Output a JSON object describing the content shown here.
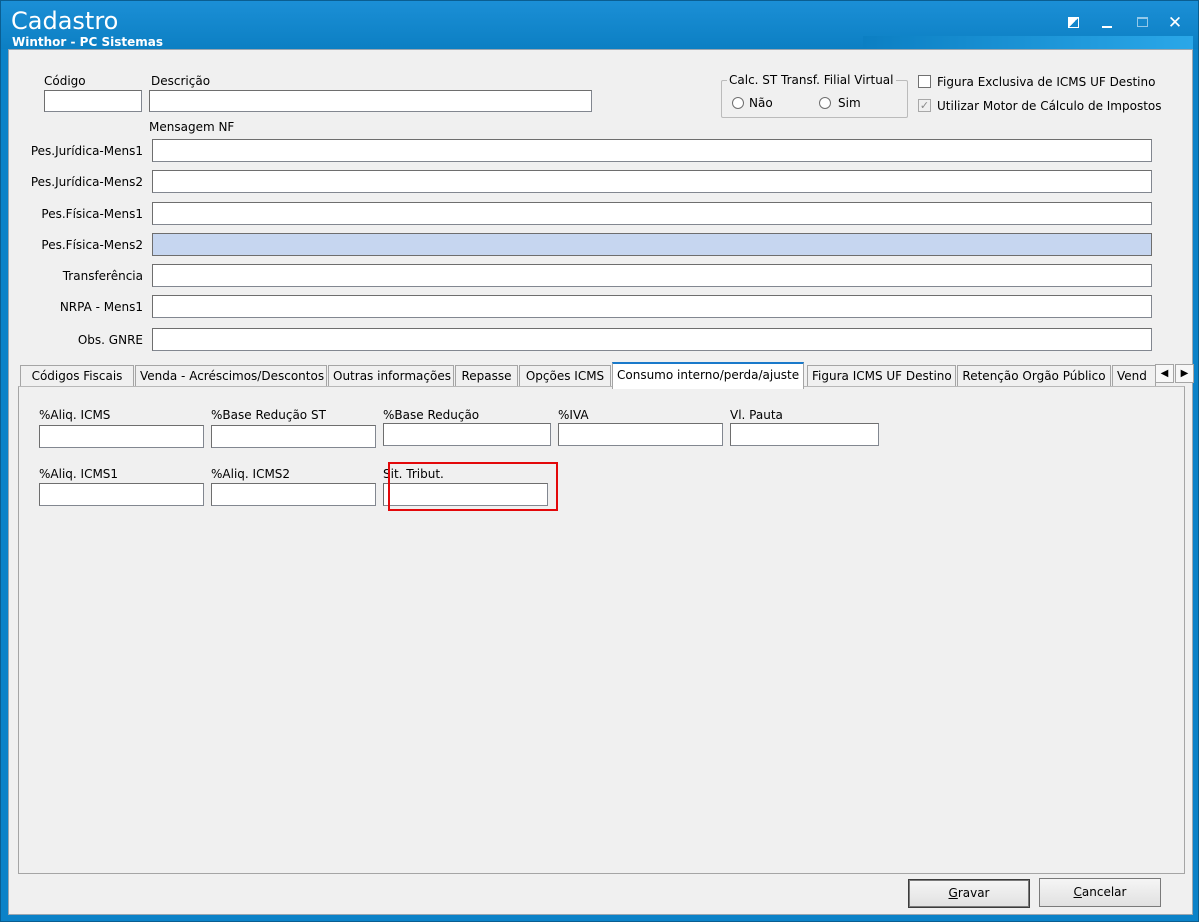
{
  "window": {
    "title": "Cadastro",
    "subtitle": "Winthor - PC Sistemas",
    "controls": {
      "restore": "restore-icon",
      "minimize": "minimize-icon",
      "maximize": "maximize-icon",
      "close": "✕"
    }
  },
  "header": {
    "codigo_label": "Código",
    "codigo_value": "",
    "descricao_label": "Descrição",
    "descricao_value": "",
    "calc_st": {
      "legend": "Calc. ST Transf. Filial Virtual",
      "options": [
        {
          "label": "Não",
          "selected": false
        },
        {
          "label": "Sim",
          "selected": false
        }
      ]
    },
    "checkboxes": [
      {
        "label": "Figura Exclusiva de ICMS UF Destino",
        "checked": false
      },
      {
        "label": "Utilizar Motor de Cálculo de Impostos",
        "checked": true
      }
    ]
  },
  "mensagem_nf": {
    "section_label": "Mensagem NF",
    "fields": [
      {
        "label": "Pes.Jurídica-Mens1",
        "value": ""
      },
      {
        "label": "Pes.Jurídica-Mens2",
        "value": ""
      },
      {
        "label": "Pes.Física-Mens1",
        "value": ""
      },
      {
        "label": "Pes.Física-Mens2",
        "value": ""
      },
      {
        "label": "Transferência",
        "value": ""
      },
      {
        "label": "NRPA - Mens1",
        "value": ""
      },
      {
        "label": "Obs. GNRE",
        "value": ""
      }
    ]
  },
  "tabs": [
    {
      "label": "Códigos Fiscais"
    },
    {
      "label": "Venda - Acréscimos/Descontos"
    },
    {
      "label": "Outras informações"
    },
    {
      "label": "Repasse"
    },
    {
      "label": "Opções ICMS"
    },
    {
      "label": "Consumo interno/perda/ajuste",
      "active": true
    },
    {
      "label": "Figura ICMS UF Destino"
    },
    {
      "label": "Retenção Orgão Público"
    },
    {
      "label": "Vend"
    }
  ],
  "tab_arrows": {
    "left": "◀",
    "right": "▶"
  },
  "consumo_panel": {
    "fields": [
      {
        "label": "%Aliq. ICMS",
        "value": ""
      },
      {
        "label": "%Base Redução ST",
        "value": ""
      },
      {
        "label": "%Base Redução",
        "value": ""
      },
      {
        "label": "%IVA",
        "value": ""
      },
      {
        "label": "Vl. Pauta",
        "value": ""
      },
      {
        "label": "%Aliq. ICMS1",
        "value": ""
      },
      {
        "label": "%Aliq. ICMS2",
        "value": ""
      },
      {
        "label": "Sit. Tribut.",
        "value": ""
      }
    ],
    "highlight_color": "#e3080a"
  },
  "footer": {
    "gravar_label": "Gravar",
    "gravar_mnemonic": "G",
    "gravar_rest": "ravar",
    "cancelar_label": "Cancelar",
    "cancelar_mnemonic": "C",
    "cancelar_rest": "ancelar"
  },
  "colors": {
    "titlebar": "#0c7fc3",
    "client_bg": "#f0f0f0",
    "selected_field": "#c6d6f0",
    "active_tab_accent": "#1979ca"
  }
}
